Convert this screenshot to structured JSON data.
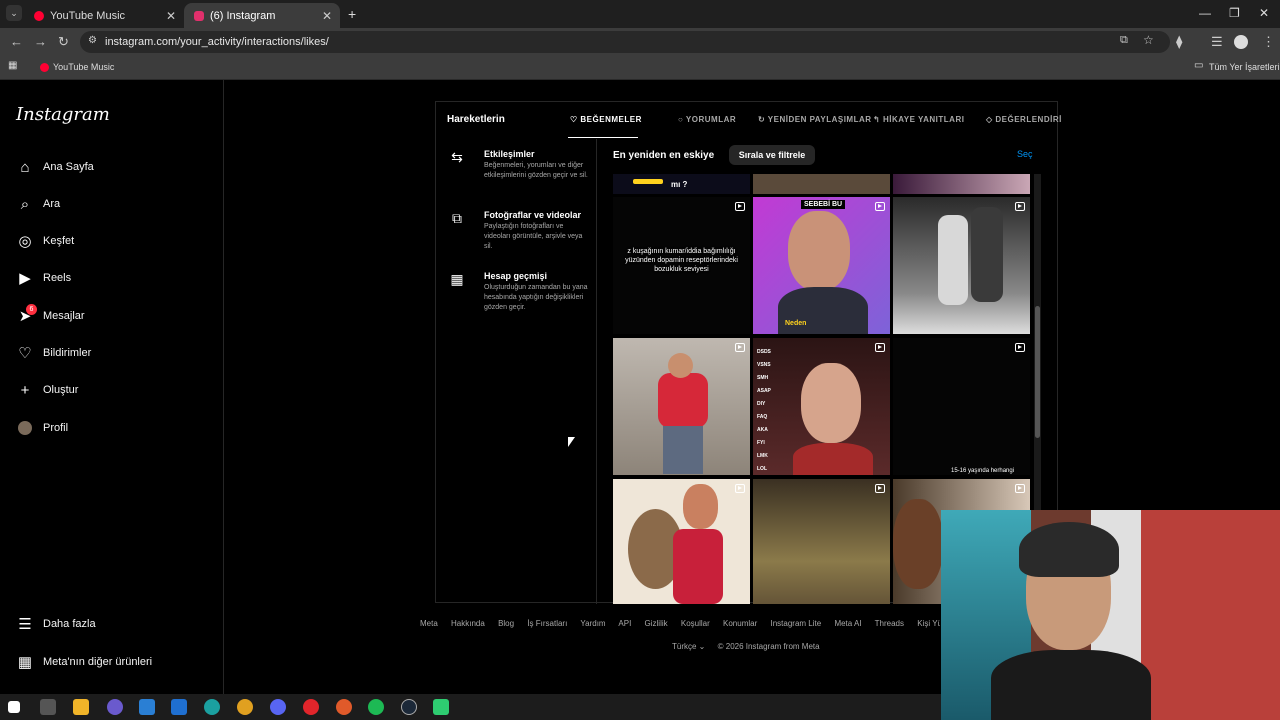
{
  "browser": {
    "tabs": [
      {
        "title": "YouTube Music",
        "active": false,
        "color": "#ff0033"
      },
      {
        "title": "(6) Instagram",
        "active": true,
        "color": "#e1306c"
      }
    ],
    "url": "instagram.com/your_activity/interactions/likes/",
    "bookmark": "YouTube Music",
    "bookmarks_folder": "Tüm Yer İşaretleri"
  },
  "sidebar": {
    "logo": "Instagram",
    "items": [
      {
        "label": "Ana Sayfa",
        "icon": "home-icon"
      },
      {
        "label": "Ara",
        "icon": "search-icon"
      },
      {
        "label": "Keşfet",
        "icon": "compass-icon"
      },
      {
        "label": "Reels",
        "icon": "reels-icon"
      },
      {
        "label": "Mesajlar",
        "icon": "messenger-icon",
        "badge": "6"
      },
      {
        "label": "Bildirimler",
        "icon": "heart-icon"
      },
      {
        "label": "Oluştur",
        "icon": "plus-icon"
      },
      {
        "label": "Profil",
        "icon": "avatar-icon"
      }
    ],
    "more": "Daha fazla",
    "meta": "Meta'nın diğer ürünleri"
  },
  "panel": {
    "title": "Hareketlerin",
    "tabs": [
      "BEĞENMELER",
      "YORUMLAR",
      "YENİDEN PAYLAŞIMLAR",
      "HİKAYE YANITLARI",
      "DEĞERLENDİRİ"
    ],
    "active_tab": "BEĞENMELER",
    "menu": [
      {
        "title": "Etkileşimler",
        "desc": "Beğenmeleri, yorumları ve diğer etkileşimlerini gözden geçir ve sil."
      },
      {
        "title": "Fotoğraflar ve videolar",
        "desc": "Paylaştığın fotoğrafları ve videoları görüntüle, arşivle veya sil."
      },
      {
        "title": "Hesap geçmişi",
        "desc": "Oluşturduğun zamandan bu yana hesabında yaptığın değişiklikleri gözden geçir."
      }
    ],
    "sort_label": "En yeniden en eskiye",
    "filter_button": "Sırala ve filtrele",
    "select_link": "Seç",
    "grid_texts": {
      "top_partial": "mı ?",
      "c1": "z kuşağının kumar/iddia bağımlılığı yüzünden dopamin reseptörlerindeki bozukluk seviyesi",
      "c2_top": "SEBEBİ BU",
      "c2_bottom": "Neden",
      "c5_list": [
        "DSDS",
        "VSNS",
        "SMH",
        "ASAP",
        "DIY",
        "FAQ",
        "AKA",
        "FYI",
        "LMK",
        "LOL"
      ],
      "c6_caption": "15-16 yaşında herhangi"
    }
  },
  "footer": {
    "links": [
      "Meta",
      "Hakkında",
      "Blog",
      "İş Fırsatları",
      "Yardım",
      "API",
      "Gizlilik",
      "Koşullar",
      "Konumlar",
      "Instagram Lite",
      "Meta AI",
      "Threads",
      "Kişi Yükleme ve H"
    ],
    "language": "Türkçe",
    "copyright": "© 2026 Instagram from Meta"
  }
}
